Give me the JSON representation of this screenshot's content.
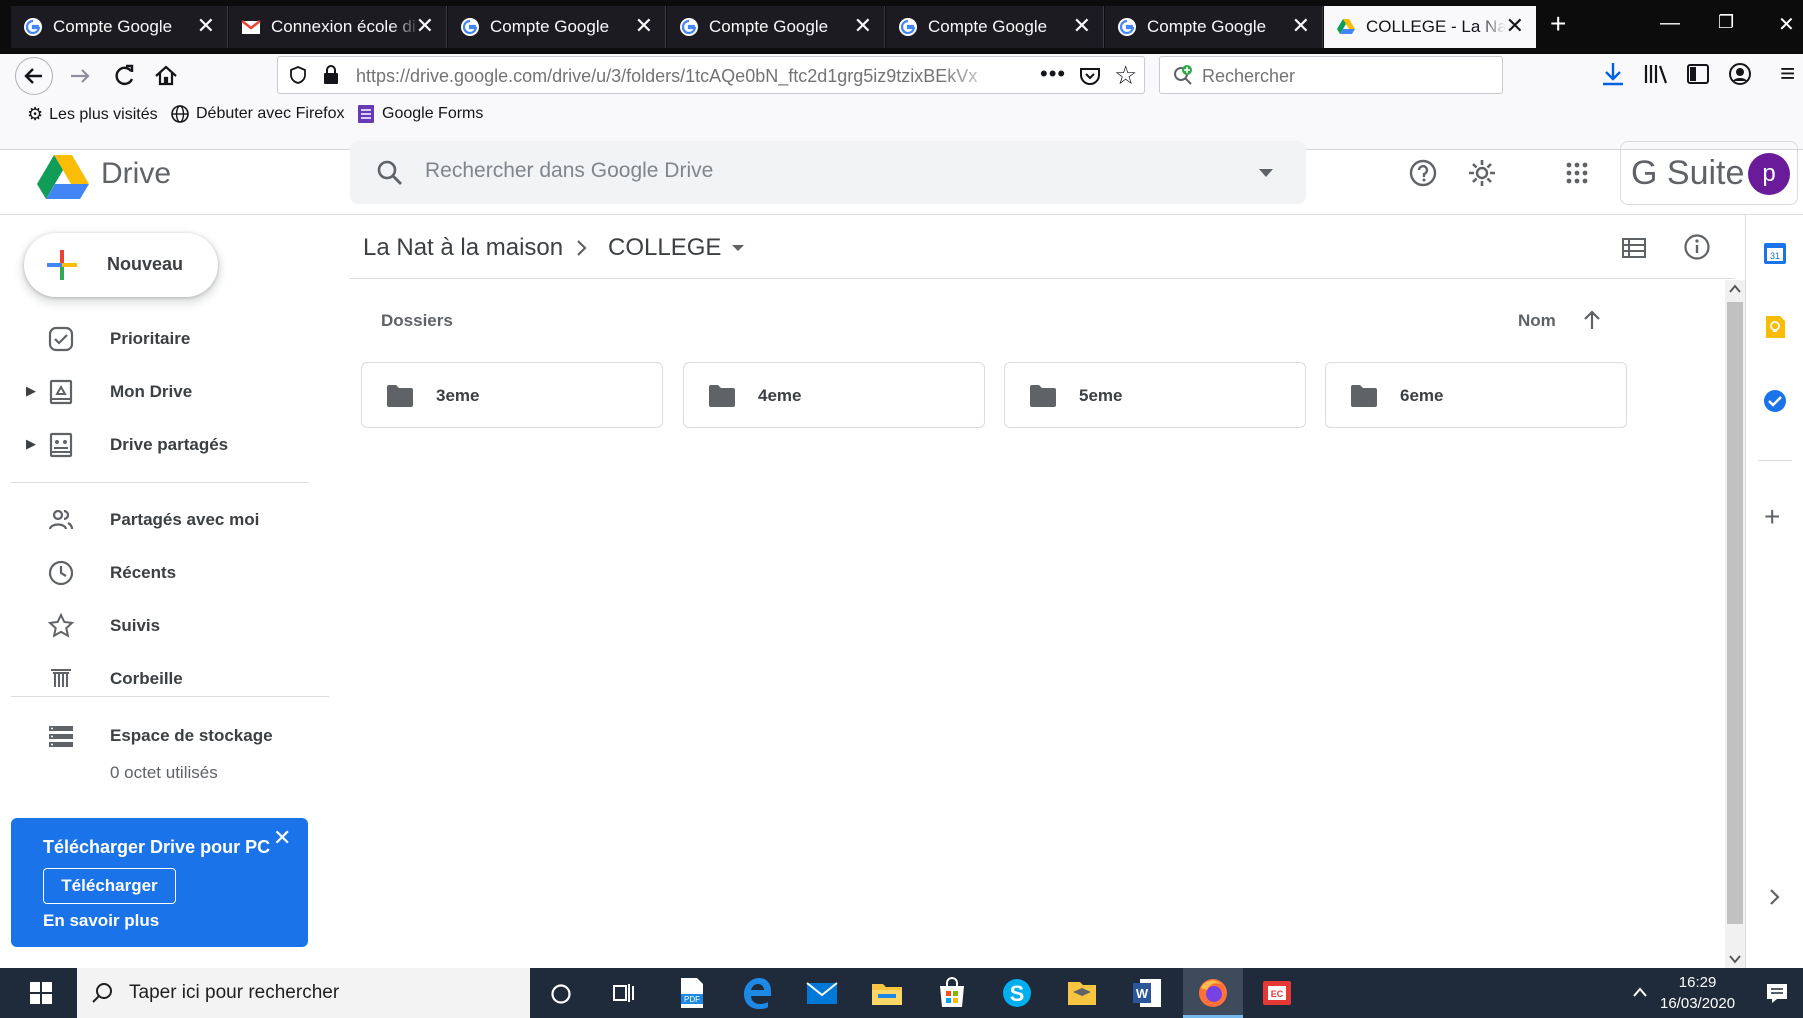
{
  "browser": {
    "tabs": [
      {
        "title": "Compte Google",
        "icon": "google-g-icon"
      },
      {
        "title": "Connexion école di",
        "icon": "gmail-icon"
      },
      {
        "title": "Compte Google",
        "icon": "google-g-icon"
      },
      {
        "title": "Compte Google",
        "icon": "google-g-icon"
      },
      {
        "title": "Compte Google",
        "icon": "google-g-icon"
      },
      {
        "title": "Compte Google",
        "icon": "google-g-icon"
      },
      {
        "title": "COLLEGE - La Nat à",
        "icon": "drive-icon",
        "active": true
      }
    ],
    "url": "https://drive.google.com/drive/u/3/folders/1tcAQe0bN_ftc2d1grg5iz9tzixBEkVx",
    "search_placeholder": "Rechercher",
    "bookmarks": [
      "Les plus visités",
      "Débuter avec Firefox",
      "Google Forms"
    ]
  },
  "drive": {
    "title": "Drive",
    "search_placeholder": "Rechercher dans Google Drive",
    "gsuite_label": "G Suite",
    "avatar_letter": "p",
    "new_button": "Nouveau",
    "nav": [
      {
        "label": "Prioritaire",
        "icon": "priority-icon"
      },
      {
        "label": "Mon Drive",
        "icon": "my-drive-icon"
      },
      {
        "label": "Drive partagés",
        "icon": "shared-drives-icon"
      },
      {
        "label": "Partagés avec moi",
        "icon": "people-icon"
      },
      {
        "label": "Récents",
        "icon": "clock-icon"
      },
      {
        "label": "Suivis",
        "icon": "star-icon"
      },
      {
        "label": "Corbeille",
        "icon": "trash-icon"
      }
    ],
    "storage": {
      "label": "Espace de stockage",
      "used": "0 octet utilisés"
    },
    "promo": {
      "title": "Télécharger Drive pour PC",
      "button": "Télécharger",
      "link": "En savoir plus"
    },
    "breadcrumb": [
      "La Nat à la maison",
      "COLLEGE"
    ],
    "section_label": "Dossiers",
    "sort_label": "Nom",
    "folders": [
      "3eme",
      "4eme",
      "5eme",
      "6eme"
    ]
  },
  "taskbar": {
    "search_placeholder": "Taper ici pour rechercher",
    "time": "16:29",
    "date": "16/03/2020"
  },
  "colors": {
    "accent": "#1a73e8",
    "avatar": "#6a1b9a"
  }
}
